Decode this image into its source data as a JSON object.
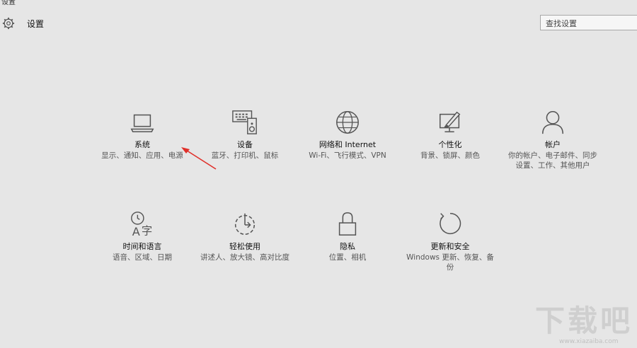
{
  "window": {
    "title": "设置"
  },
  "header": {
    "title": "设置",
    "gear_icon": "gear-icon"
  },
  "search": {
    "placeholder": "查找设置"
  },
  "tiles": [
    {
      "title": "系统",
      "desc": "显示、通知、应用、电源",
      "icon": "laptop-icon"
    },
    {
      "title": "设备",
      "desc": "蓝牙、打印机、鼠标",
      "icon": "devices-icon"
    },
    {
      "title": "网络和 Internet",
      "desc": "Wi-Fi、飞行模式、VPN",
      "icon": "globe-icon"
    },
    {
      "title": "个性化",
      "desc": "背景、锁屏、颜色",
      "icon": "personalization-icon"
    },
    {
      "title": "帐户",
      "desc": "你的帐户、电子邮件、同步设置、工作、其他用户",
      "icon": "person-icon"
    },
    {
      "title": "时间和语言",
      "desc": "语音、区域、日期",
      "icon": "time-language-icon"
    },
    {
      "title": "轻松使用",
      "desc": "讲述人、放大镜、高对比度",
      "icon": "ease-of-access-icon"
    },
    {
      "title": "隐私",
      "desc": "位置、相机",
      "icon": "lock-icon"
    },
    {
      "title": "更新和安全",
      "desc": "Windows 更新、恢复、备份",
      "icon": "refresh-icon"
    }
  ],
  "watermark": {
    "text": "下载吧",
    "url": "www.xiazaiba.com"
  },
  "colors": {
    "background": "#e6e6e6",
    "icon": "#555555",
    "arrow": "#e0302a"
  }
}
